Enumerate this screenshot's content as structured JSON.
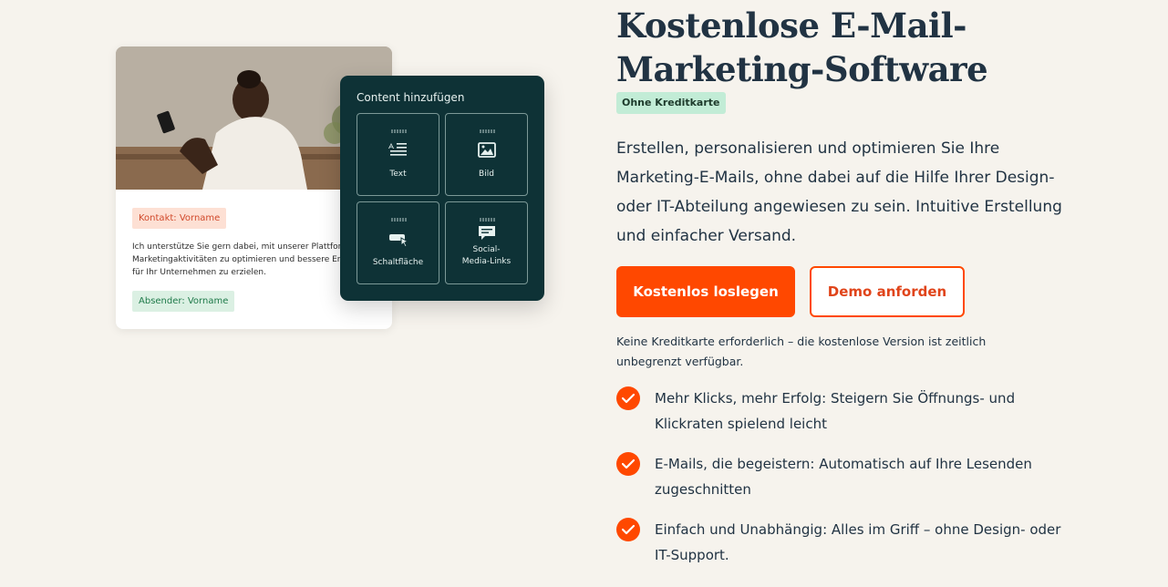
{
  "illustration": {
    "contact_tag": "Kontakt: Vorname",
    "body_text": "Ich unterstütze Sie gern dabei, mit unserer Plattform\nMarketingaktivitäten zu optimieren und bessere Erge\nfür Ihr Unternehmen zu erzielen.",
    "sender_tag": "Absender: Vorname",
    "panel": {
      "title": "Content hinzufügen",
      "tiles": [
        {
          "label": "Text",
          "icon": "text-align-icon"
        },
        {
          "label": "Bild",
          "icon": "image-icon"
        },
        {
          "label": "Schaltfläche",
          "icon": "button-cursor-icon"
        },
        {
          "label": "Social-\nMedia-Links",
          "icon": "speech-bubble-icon"
        }
      ]
    }
  },
  "hero": {
    "title": "Kostenlose E-Mail-Marketing-Software",
    "badge": "Ohne Kreditkarte",
    "lead": "Erstellen, personalisieren und optimieren Sie Ihre Marketing-E-Mails, ohne dabei auf die Hilfe Ihrer Design- oder IT-Abteilung angewiesen zu sein. Intuitive Erstellung und einfacher Versand.",
    "primary_cta": "Kostenlos loslegen",
    "secondary_cta": "Demo anforden",
    "note": "Keine Kreditkarte erforderlich – die kostenlose Version ist zeitlich unbegrenzt verfügbar.",
    "features": [
      "Mehr Klicks, mehr Erfolg: Steigern Sie Öffnungs- und Klickraten spielend leicht",
      "E-Mails, die begeistern: Automatisch auf Ihre Lesenden zugeschnitten",
      "Einfach und Unabhängig: Alles im Griff – ohne Design- oder IT-Support."
    ]
  },
  "colors": {
    "background": "#f6f3ed",
    "accent": "#ff4800",
    "panel": "#0e3236",
    "badge": "#c2ecd6"
  }
}
